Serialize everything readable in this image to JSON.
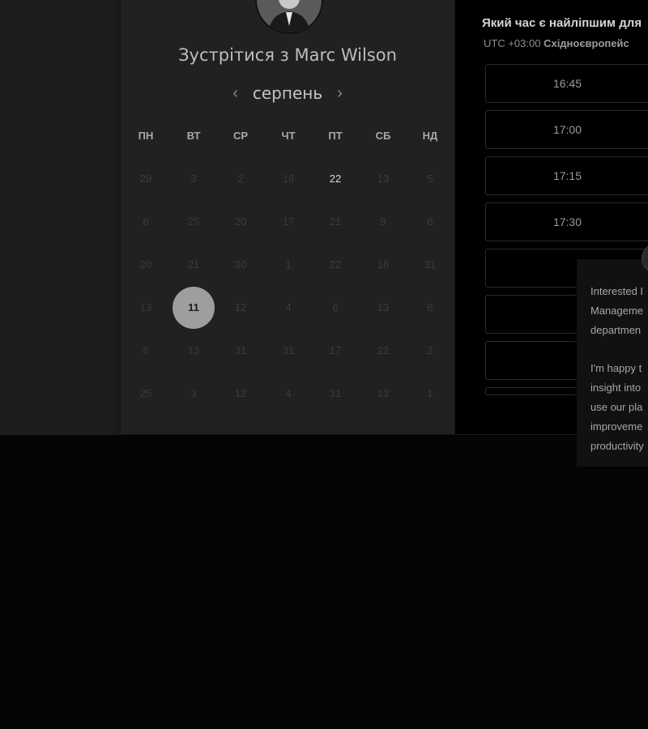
{
  "organizer": {
    "title": "Зустрітися з Marc Wilson",
    "avatar_icon": "person-photo"
  },
  "calendar": {
    "month": "серпень",
    "prev_icon": "chevron-left",
    "next_icon": "chevron-right",
    "weekdays": [
      "ПН",
      "ВТ",
      "СР",
      "ЧТ",
      "ПТ",
      "СБ",
      "НД"
    ],
    "weeks": [
      [
        "29",
        "3",
        "2",
        "18",
        "22",
        "13",
        "5"
      ],
      [
        "6",
        "25",
        "20",
        "17",
        "21",
        "9",
        "6"
      ],
      [
        "20",
        "21",
        "30",
        "1",
        "22",
        "16",
        "31"
      ],
      [
        "13",
        "11",
        "12",
        "4",
        "6",
        "13",
        "6"
      ],
      [
        "8",
        "13",
        "31",
        "31",
        "17",
        "22",
        "2"
      ],
      [
        "25",
        "3",
        "12",
        "4",
        "31",
        "13",
        "1"
      ]
    ],
    "highlighted_day": "22",
    "selected_day": "11"
  },
  "times": {
    "heading": "Який час є найліпшим для",
    "tz_offset": "UTC +03:00",
    "tz_name": "Східноєвропейс",
    "slots": [
      "16:45",
      "17:00",
      "17:15",
      "17:30"
    ]
  },
  "popup": {
    "close_icon": "close-x",
    "lines": [
      "Interested I",
      "Manageme",
      "departmen",
      "",
      "I'm happy t",
      "insight into",
      "use our pla",
      "improveme",
      "productivity"
    ]
  },
  "colors": {
    "background": "#1d1d1d",
    "panel": "#212121",
    "selected_day": "#9e9e9e"
  }
}
